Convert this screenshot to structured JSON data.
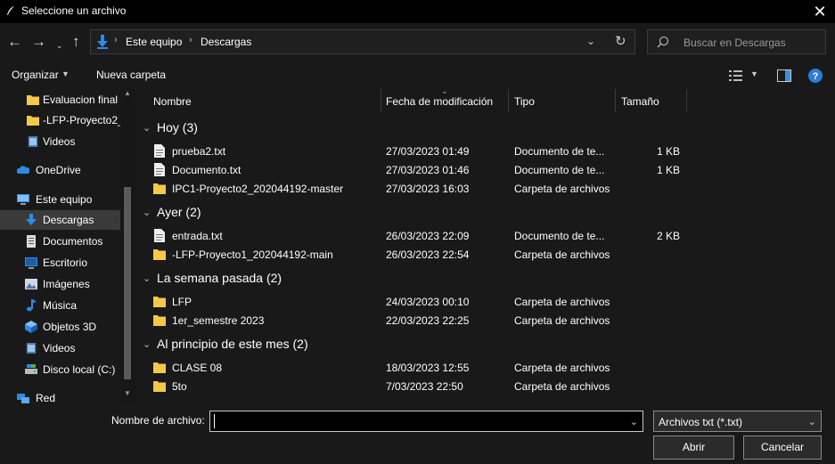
{
  "window": {
    "title": "Seleccione un archivo"
  },
  "nav": {
    "breadcrumb": [
      "Este equipo",
      "Descargas"
    ],
    "search_placeholder": "Buscar en Descargas"
  },
  "toolbar": {
    "organize": "Organizar",
    "new_folder": "Nueva carpeta"
  },
  "sidebar": {
    "items": [
      {
        "label": "Evaluacion final",
        "icon": "folder-icon"
      },
      {
        "label": "-LFP-Proyecto2_",
        "icon": "folder-icon"
      },
      {
        "label": "Videos",
        "icon": "videos-icon"
      },
      {
        "label": "OneDrive",
        "icon": "onedrive-icon"
      },
      {
        "label": "Este equipo",
        "icon": "computer-icon"
      },
      {
        "label": "Descargas",
        "icon": "download-icon",
        "selected": true
      },
      {
        "label": "Documentos",
        "icon": "documents-icon"
      },
      {
        "label": "Escritorio",
        "icon": "desktop-icon"
      },
      {
        "label": "Imágenes",
        "icon": "pictures-icon"
      },
      {
        "label": "Música",
        "icon": "music-icon"
      },
      {
        "label": "Objetos 3D",
        "icon": "objects3d-icon"
      },
      {
        "label": "Videos",
        "icon": "videos-icon"
      },
      {
        "label": "Disco local (C:)",
        "icon": "drive-icon"
      },
      {
        "label": "Red",
        "icon": "network-icon"
      }
    ]
  },
  "columns": {
    "name": "Nombre",
    "date": "Fecha de modificación",
    "type": "Tipo",
    "size": "Tamaño"
  },
  "groups": [
    {
      "label": "Hoy (3)",
      "files": [
        {
          "name": "prueba2.txt",
          "date": "27/03/2023 01:49",
          "type": "Documento de te...",
          "size": "1 KB",
          "icon": "text-file-icon"
        },
        {
          "name": "Documento.txt",
          "date": "27/03/2023 01:46",
          "type": "Documento de te...",
          "size": "1 KB",
          "icon": "text-file-icon"
        },
        {
          "name": "IPC1-Proyecto2_202044192-master",
          "date": "27/03/2023 16:03",
          "type": "Carpeta de archivos",
          "size": "",
          "icon": "folder-icon"
        }
      ]
    },
    {
      "label": "Ayer (2)",
      "files": [
        {
          "name": "entrada.txt",
          "date": "26/03/2023 22:09",
          "type": "Documento de te...",
          "size": "2 KB",
          "icon": "text-file-icon"
        },
        {
          "name": "-LFP-Proyecto1_202044192-main",
          "date": "26/03/2023 22:54",
          "type": "Carpeta de archivos",
          "size": "",
          "icon": "folder-icon"
        }
      ]
    },
    {
      "label": "La semana pasada (2)",
      "files": [
        {
          "name": "LFP",
          "date": "24/03/2023 00:10",
          "type": "Carpeta de archivos",
          "size": "",
          "icon": "folder-icon"
        },
        {
          "name": "1er_semestre 2023",
          "date": "22/03/2023 22:25",
          "type": "Carpeta de archivos",
          "size": "",
          "icon": "folder-icon"
        }
      ]
    },
    {
      "label": "Al principio de este mes (2)",
      "files": [
        {
          "name": "CLASE 08",
          "date": "18/03/2023 12:55",
          "type": "Carpeta de archivos",
          "size": "",
          "icon": "folder-icon"
        },
        {
          "name": "5to",
          "date": "7/03/2023 22:50",
          "type": "Carpeta de archivos",
          "size": "",
          "icon": "folder-icon"
        }
      ]
    }
  ],
  "footer": {
    "filename_label": "Nombre de archivo:",
    "filename_value": "",
    "filter": "Archivos txt (*.txt)",
    "open": "Abrir",
    "cancel": "Cancelar"
  },
  "colors": {
    "background": "#191919",
    "selection": "#3a3a3a",
    "folder": "#f3c94a",
    "accent": "#2d8ae6"
  }
}
